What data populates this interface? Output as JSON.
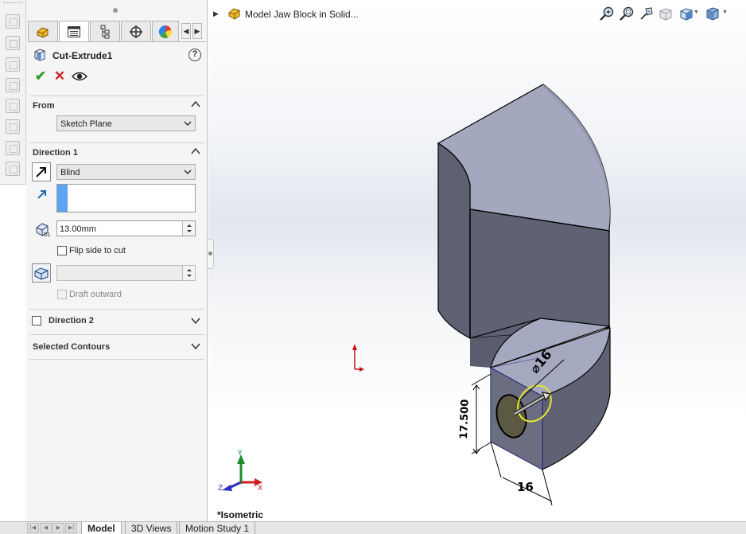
{
  "property_manager": {
    "tabs": [
      "featuremanager-tree-icon",
      "propertymanager-icon",
      "configurationmanager-icon",
      "dimxpertmanager-icon",
      "displaymanager-icon"
    ],
    "feature_title": "Cut-Extrude1",
    "help_glyph": "?",
    "actions": {
      "ok": "✔",
      "cancel": "✕",
      "preview": "eye-icon"
    },
    "from": {
      "header": "From",
      "value": "Sketch Plane"
    },
    "direction1": {
      "header": "Direction 1",
      "end_condition": "Blind",
      "depth": "13.00mm",
      "flip_side_label": "Flip side to cut",
      "flip_side_checked": false,
      "draft_value": "",
      "draft_outward_label": "Draft outward",
      "draft_outward_enabled": false
    },
    "direction2": {
      "header": "Direction 2",
      "checked": false
    },
    "selected_contours": {
      "header": "Selected Contours"
    }
  },
  "viewport": {
    "breadcrumb": "Model Jaw Block in Solid...",
    "view_name": "*Isometric",
    "dimensions": {
      "diameter": "⌀16",
      "height": "17.500",
      "width": "16"
    },
    "triad_labels": {
      "x": "X",
      "y": "Y",
      "z": "Z"
    }
  },
  "bottom_tabs": {
    "model": "Model",
    "views3d": "3D Views",
    "motion": "Motion Study 1"
  },
  "colors": {
    "part_face_top": "#a3a7bf",
    "part_face_side": "#5e6174",
    "accent_blue": "#5aa4f2",
    "ok_green": "#2f9e2f",
    "cancel_red": "#d22222"
  }
}
